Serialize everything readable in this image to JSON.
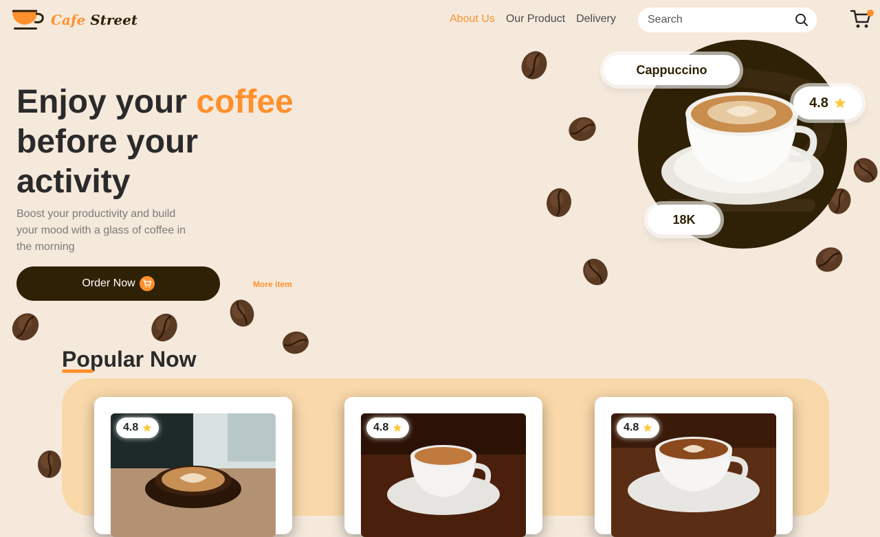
{
  "brand": {
    "name_part1": "Cafe",
    "name_part2": "Street"
  },
  "nav": {
    "items": [
      "About Us",
      "Our Product",
      "Delivery"
    ],
    "active_index": 0
  },
  "search": {
    "placeholder": "Search"
  },
  "hero": {
    "title_part1": "Enjoy your ",
    "title_accent": "coffee",
    "title_part2": "before your",
    "title_part3": "activity",
    "subtitle": "Boost your productivity and build your mood with a glass of coffee in the morning",
    "order_button": "Order Now",
    "more_link": "More item"
  },
  "feature": {
    "name": "Cappuccino",
    "rating": "4.8",
    "count": "18K"
  },
  "popular": {
    "title": "Popular Now",
    "cards": [
      {
        "rating": "4.8"
      },
      {
        "rating": "4.8"
      },
      {
        "rating": "4.8"
      }
    ]
  },
  "colors": {
    "accent": "#ff902b",
    "dark": "#2f2105",
    "background": "#f5e9dc",
    "panel": "#f9d9aa"
  },
  "icons": [
    "cup-logo-icon",
    "search-icon",
    "cart-icon",
    "cart-small-icon",
    "star-icon",
    "coffee-bean-icon"
  ]
}
